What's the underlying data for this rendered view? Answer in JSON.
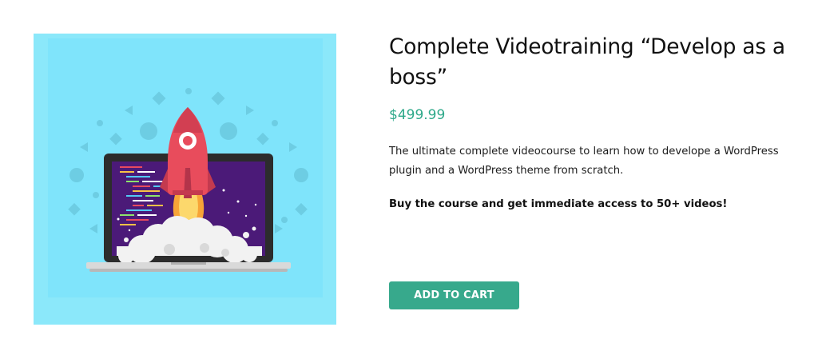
{
  "product": {
    "title": "Complete Videotraining “Develop as a boss”",
    "price": "$499.99",
    "description": "The ultimate complete videocourse to learn how to develope a WordPress plugin and a WordPress theme from scratch.",
    "cta_text": "Buy the course and get immediate access to 50+ videos!",
    "add_to_cart_label": "ADD TO CART",
    "image_icon": "rocket-laptop-illustration"
  },
  "colors": {
    "image_background": "#8be8fa",
    "price": "#2ea98a",
    "button_background": "#37a98c",
    "button_text": "#ffffff"
  }
}
